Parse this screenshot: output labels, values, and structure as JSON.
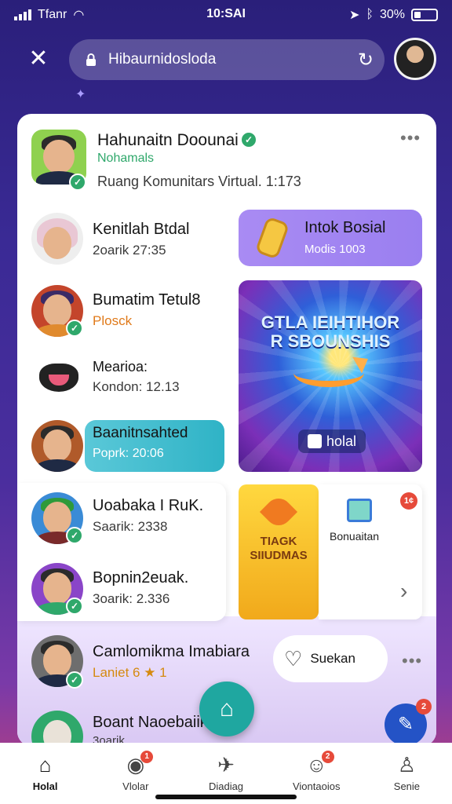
{
  "status_bar": {
    "carrier": "Tfanr",
    "time": "10:SAI",
    "battery": "30%",
    "battery_level": 0.3
  },
  "top_bar": {
    "close_icon": "close-icon",
    "search_text": "Hibaurnidosloda",
    "lock_icon": "lock-icon",
    "refresh_icon": "refresh-icon"
  },
  "feed": {
    "header_post": {
      "name": "Hahunaitn Doounai",
      "tag": "Nohamals",
      "subtitle": "Ruang Komunitars Virtual. 1:173"
    },
    "items": [
      {
        "title": "Kenitlah Btdal",
        "sub": "2oarik 27:35"
      },
      {
        "title": "Bumatim Tetul8",
        "sub": "Plosck"
      },
      {
        "title": "Mearioa:",
        "sub": "Kondon: 12.13"
      },
      {
        "title": "Baanitnsahted",
        "sub": "Poprk: 20:06"
      },
      {
        "title": "Uoabaka I RuK.",
        "sub": "Saarik: 2338"
      },
      {
        "title": "Bopnin2euak.",
        "sub": "3oarik: 2.336"
      },
      {
        "title": "Camlomikma Imabiara",
        "sub": "Laniet 6 ★ 1"
      },
      {
        "title": "Boant Naoebaiik",
        "sub": "3oarik"
      }
    ],
    "tile_music": {
      "title": "Intok Bosial",
      "sub": "Modis 1003"
    },
    "banner": {
      "headline": "GTLA IEIHTIHOR\nR SBOUNSHIS",
      "app": "holal"
    },
    "game_tile": {
      "title": "TIAGK\nSIIUDMAS"
    },
    "right_tile": {
      "label": "Bonuaitan",
      "badge": "1¢"
    },
    "chip": {
      "label": "Suekan"
    }
  },
  "fab2_badge": "2",
  "tabs": [
    {
      "label": "Holal",
      "icon": "home-icon",
      "active": true
    },
    {
      "label": "Vlolar",
      "icon": "video-icon",
      "badge": "1"
    },
    {
      "label": "Diadiag",
      "icon": "compass-icon"
    },
    {
      "label": "Viontaoios",
      "icon": "people-icon",
      "badge": "2"
    },
    {
      "label": "Senie",
      "icon": "person-icon"
    }
  ],
  "colors": {
    "accent": "#1fa7a0",
    "verified": "#2fa86b",
    "badge": "#e64a3a"
  }
}
